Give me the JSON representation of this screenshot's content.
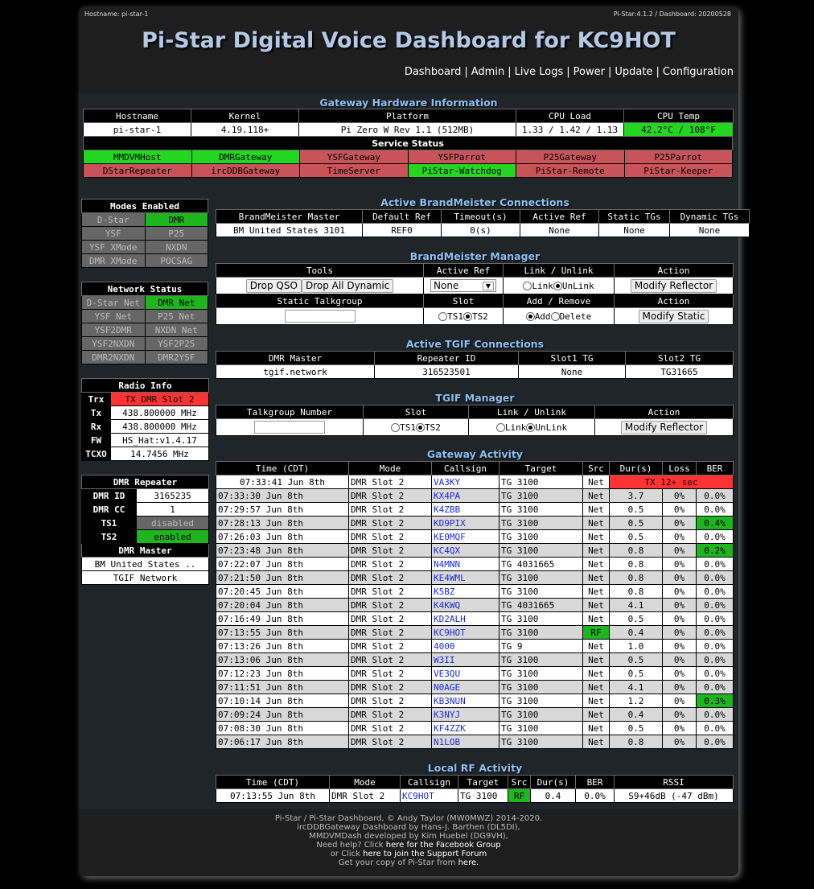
{
  "header": {
    "hostname_label": "Hostname: pi-star-1",
    "version": "Pi-Star:4.1.2 / Dashboard: 20200528",
    "title": "Pi-Star Digital Voice Dashboard for KC9HOT",
    "nav": [
      "Dashboard",
      "Admin",
      "Live Logs",
      "Power",
      "Update",
      "Configuration"
    ]
  },
  "hardware": {
    "title": "Gateway Hardware Information",
    "cols": [
      "Hostname",
      "Kernel",
      "Platform",
      "CPU Load",
      "CPU Temp"
    ],
    "values": [
      "pi-star-1",
      "4.19.118+",
      "Pi Zero W Rev 1.1 (512MB)",
      "1.33 / 1.42 / 1.13",
      "42.2°C / 108°F"
    ],
    "service_title": "Service Status",
    "services": [
      [
        "MMDVMHost",
        "DMRGateway",
        "YSFGateway",
        "YSFParrot",
        "P25Gateway",
        "P25Parrot"
      ],
      [
        "DStarRepeater",
        "ircDDBGateway",
        "TimeServer",
        "PiStar-Watchdog",
        "PiStar-Remote",
        "PiStar-Keeper"
      ]
    ]
  },
  "modes": {
    "title": "Modes Enabled",
    "rows": [
      [
        "D-Star",
        "DMR"
      ],
      [
        "YSF",
        "P25"
      ],
      [
        "YSF XMode",
        "NXDN"
      ],
      [
        "DMR XMode",
        "POCSAG"
      ]
    ]
  },
  "network": {
    "title": "Network Status",
    "rows": [
      [
        "D-Star Net",
        "DMR Net"
      ],
      [
        "YSF Net",
        "P25 Net"
      ],
      [
        "YSF2DMR",
        "NXDN Net"
      ],
      [
        "YSF2NXDN",
        "YSF2P25"
      ],
      [
        "DMR2NXDN",
        "DMR2YSF"
      ]
    ]
  },
  "radio": {
    "title": "Radio Info",
    "rows": [
      [
        "Trx",
        "TX DMR Slot 2"
      ],
      [
        "Tx",
        "438.800000 MHz"
      ],
      [
        "Rx",
        "438.800000 MHz"
      ],
      [
        "FW",
        "HS_Hat:v1.4.17"
      ],
      [
        "TCXO",
        "14.7456 MHz"
      ]
    ]
  },
  "dmr": {
    "title": "DMR Repeater",
    "rows": [
      [
        "DMR ID",
        "3165235"
      ],
      [
        "DMR CC",
        "1"
      ],
      [
        "TS1",
        "disabled"
      ],
      [
        "TS2",
        "enabled"
      ]
    ],
    "master_title": "DMR Master",
    "masters": [
      "BM United States ..",
      "TGIF Network"
    ]
  },
  "bm": {
    "title": "Active BrandMeister Connections",
    "cols": [
      "BrandMeister Master",
      "Default Ref",
      "Timeout(s)",
      "Active Ref",
      "Static TGs",
      "Dynamic TGs"
    ],
    "values": [
      "BM United States 3101",
      "REF0",
      "0(s)",
      "None",
      "None",
      "None"
    ]
  },
  "bmm": {
    "title": "BrandMeister Manager",
    "cols1": [
      "Tools",
      "Active Ref",
      "Link / Unlink",
      "Action"
    ],
    "drop_qso": "Drop QSO",
    "drop_all": "Drop All Dynamic",
    "ref_sel": "None",
    "link": "Link",
    "unlink": "UnLink",
    "modify_reflector": "Modify Reflector",
    "cols2": [
      "Static Talkgroup",
      "Slot",
      "Add / Remove",
      "Action"
    ],
    "ts1": "TS1",
    "ts2": "TS2",
    "add": "Add",
    "delete": "Delete",
    "modify_static": "Modify Static"
  },
  "tgif": {
    "title": "Active TGIF Connections",
    "cols": [
      "DMR Master",
      "Repeater ID",
      "Slot1 TG",
      "Slot2 TG"
    ],
    "values": [
      "tgif.network",
      "316523501",
      "None",
      "TG31665"
    ]
  },
  "tgifm": {
    "title": "TGIF Manager",
    "cols": [
      "Talkgroup Number",
      "Slot",
      "Link / Unlink",
      "Action"
    ],
    "ts1": "TS1",
    "ts2": "TS2",
    "link": "Link",
    "unlink": "UnLink",
    "modify": "Modify Reflector"
  },
  "activity": {
    "title": "Gateway Activity",
    "cols": [
      "Time (CDT)",
      "Mode",
      "Callsign",
      "Target",
      "Src",
      "Dur(s)",
      "Loss",
      "BER"
    ],
    "rows": [
      [
        "07:33:41 Jun 8th",
        "DMR Slot 2",
        "VA3KY",
        "TG 3100",
        "Net",
        "TX 12+ sec",
        "",
        ""
      ],
      [
        "07:33:30 Jun 8th",
        "DMR Slot 2",
        "KX4PA",
        "TG 3100",
        "Net",
        "3.7",
        "0%",
        "0.0%"
      ],
      [
        "07:29:57 Jun 8th",
        "DMR Slot 2",
        "K4ZBB",
        "TG 3100",
        "Net",
        "0.5",
        "0%",
        "0.0%"
      ],
      [
        "07:28:13 Jun 8th",
        "DMR Slot 2",
        "KD9PIX",
        "TG 3100",
        "Net",
        "0.5",
        "0%",
        "0.4%"
      ],
      [
        "07:26:03 Jun 8th",
        "DMR Slot 2",
        "KE0MQF",
        "TG 3100",
        "Net",
        "0.5",
        "0%",
        "0.0%"
      ],
      [
        "07:23:48 Jun 8th",
        "DMR Slot 2",
        "KC4QX",
        "TG 3100",
        "Net",
        "0.8",
        "0%",
        "0.2%"
      ],
      [
        "07:22:07 Jun 8th",
        "DMR Slot 2",
        "N4MNN",
        "TG 4031665",
        "Net",
        "0.8",
        "0%",
        "0.0%"
      ],
      [
        "07:21:50 Jun 8th",
        "DMR Slot 2",
        "KE4WML",
        "TG 3100",
        "Net",
        "0.8",
        "0%",
        "0.0%"
      ],
      [
        "07:20:45 Jun 8th",
        "DMR Slot 2",
        "K5BZ",
        "TG 3100",
        "Net",
        "0.8",
        "0%",
        "0.0%"
      ],
      [
        "07:20:04 Jun 8th",
        "DMR Slot 2",
        "K4KWQ",
        "TG 4031665",
        "Net",
        "4.1",
        "0%",
        "0.0%"
      ],
      [
        "07:16:49 Jun 8th",
        "DMR Slot 2",
        "KD2ALH",
        "TG 3100",
        "Net",
        "0.5",
        "0%",
        "0.0%"
      ],
      [
        "07:13:55 Jun 8th",
        "DMR Slot 2",
        "KC9HOT",
        "TG 3100",
        "RF",
        "0.4",
        "0%",
        "0.0%"
      ],
      [
        "07:13:26 Jun 8th",
        "DMR Slot 2",
        "4000",
        "TG 9",
        "Net",
        "1.0",
        "0%",
        "0.0%"
      ],
      [
        "07:13:06 Jun 8th",
        "DMR Slot 2",
        "W3II",
        "TG 3100",
        "Net",
        "0.5",
        "0%",
        "0.0%"
      ],
      [
        "07:12:23 Jun 8th",
        "DMR Slot 2",
        "VE3QU",
        "TG 3100",
        "Net",
        "0.5",
        "0%",
        "0.0%"
      ],
      [
        "07:11:51 Jun 8th",
        "DMR Slot 2",
        "N0AGE",
        "TG 3100",
        "Net",
        "4.1",
        "0%",
        "0.0%"
      ],
      [
        "07:10:14 Jun 8th",
        "DMR Slot 2",
        "KB3NUN",
        "TG 3100",
        "Net",
        "1.2",
        "0%",
        "0.3%"
      ],
      [
        "07:09:24 Jun 8th",
        "DMR Slot 2",
        "K3NYJ",
        "TG 3100",
        "Net",
        "0.4",
        "0%",
        "0.0%"
      ],
      [
        "07:08:30 Jun 8th",
        "DMR Slot 2",
        "KF4ZZK",
        "TG 3100",
        "Net",
        "0.5",
        "0%",
        "0.0%"
      ],
      [
        "07:06:17 Jun 8th",
        "DMR Slot 2",
        "N1LOB",
        "TG 3100",
        "Net",
        "0.8",
        "0%",
        "0.0%"
      ]
    ]
  },
  "localrf": {
    "title": "Local RF Activity",
    "cols": [
      "Time (CDT)",
      "Mode",
      "Callsign",
      "Target",
      "Src",
      "Dur(s)",
      "BER",
      "RSSI"
    ],
    "row": [
      "07:13:55 Jun 8th",
      "DMR Slot 2",
      "KC9HOT",
      "TG 3100",
      "RF",
      "0.4",
      "0.0%",
      "S9+46dB (-47 dBm)"
    ]
  },
  "footer": {
    "l1": "Pi-Star / Pi-Star Dashboard, © Andy Taylor (MW0MWZ) 2014-2020.",
    "l2": "ircDDBGateway Dashboard by Hans-J. Barthen (DL5DI),",
    "l3": "MMDVMDash developed by Kim Huebel (DG9VH),",
    "l4a": "Need help? Click ",
    "l4b": "here for the Facebook Group",
    "l5a": "or Click ",
    "l5b": "here to join the Support Forum",
    "l6a": "Get your copy of Pi-Star from ",
    "l6b": "here."
  },
  "colors": {
    "title": "#b4c9e6",
    "section": "#8cc1f3",
    "ok": "#23d620",
    "bad": "#c8545a",
    "tx": "#ff3333"
  }
}
